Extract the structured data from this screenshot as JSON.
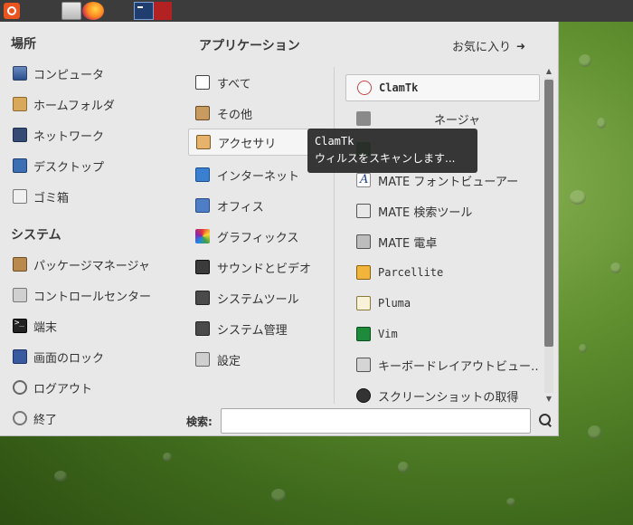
{
  "panel": {
    "items": [
      {
        "icon": "mate-menu-icon"
      },
      {
        "icon": "file-manager-icon"
      },
      {
        "icon": "firefox-icon"
      },
      {
        "icon": "terminal-window-icon"
      },
      {
        "icon": "app-window-icon"
      }
    ]
  },
  "places": {
    "title": "場所",
    "items": [
      {
        "label": "コンピュータ",
        "icon": "computer-icon"
      },
      {
        "label": "ホームフォルダ",
        "icon": "home-folder-icon"
      },
      {
        "label": "ネットワーク",
        "icon": "network-icon"
      },
      {
        "label": "デスクトップ",
        "icon": "desktop-icon"
      },
      {
        "label": "ゴミ箱",
        "icon": "trash-icon"
      }
    ]
  },
  "system": {
    "title": "システム",
    "items": [
      {
        "label": "パッケージマネージャ",
        "icon": "package-icon"
      },
      {
        "label": "コントロールセンター",
        "icon": "control-center-icon"
      },
      {
        "label": "端末",
        "icon": "terminal-icon"
      },
      {
        "label": "画面のロック",
        "icon": "lock-screen-icon"
      },
      {
        "label": "ログアウト",
        "icon": "logout-icon"
      },
      {
        "label": "終了",
        "icon": "power-icon"
      }
    ]
  },
  "applications": {
    "title": "アプリケーション",
    "favorites_label": "お気に入り",
    "categories": [
      {
        "label": "すべて",
        "icon": "all-apps-icon"
      },
      {
        "label": "その他",
        "icon": "other-icon"
      },
      {
        "label": "アクセサリ",
        "icon": "accessories-icon",
        "active": true
      },
      {
        "label": "インターネット",
        "icon": "internet-icon"
      },
      {
        "label": "オフィス",
        "icon": "office-icon"
      },
      {
        "label": "グラフィックス",
        "icon": "graphics-icon"
      },
      {
        "label": "サウンドとビデオ",
        "icon": "sound-video-icon"
      },
      {
        "label": "システムツール",
        "icon": "system-tools-icon"
      },
      {
        "label": "システム管理",
        "icon": "system-admin-icon"
      },
      {
        "label": "設定",
        "icon": "settings-icon"
      }
    ],
    "apps": [
      {
        "label": "ClamTk",
        "icon": "clamtk-icon",
        "selected": true
      },
      {
        "label": "ネージャ",
        "icon": "app-icon"
      },
      {
        "label": "",
        "icon": "app-icon"
      },
      {
        "label": "MATE フォントビューアー",
        "icon": "font-viewer-icon"
      },
      {
        "label": "MATE 検索ツール",
        "icon": "search-tool-icon"
      },
      {
        "label": "MATE 電卓",
        "icon": "calculator-icon"
      },
      {
        "label": "Parcellite",
        "icon": "parcellite-icon"
      },
      {
        "label": "Pluma",
        "icon": "pluma-icon"
      },
      {
        "label": "Vim",
        "icon": "vim-icon"
      },
      {
        "label": "キーボードレイアウトビュー…",
        "icon": "keyboard-layout-icon"
      },
      {
        "label": "スクリーンショットの取得",
        "icon": "screenshot-icon"
      }
    ]
  },
  "tooltip": {
    "title": "ClamTk",
    "description": "ウィルスをスキャンします..."
  },
  "search": {
    "label": "検索:",
    "value": "",
    "placeholder": ""
  },
  "colors": {
    "menu_bg": "#e8e8e8",
    "panel_bg": "#3c3c3c",
    "desktop_green": "#5f8f2f",
    "tooltip_bg": "#2a2a2a"
  }
}
